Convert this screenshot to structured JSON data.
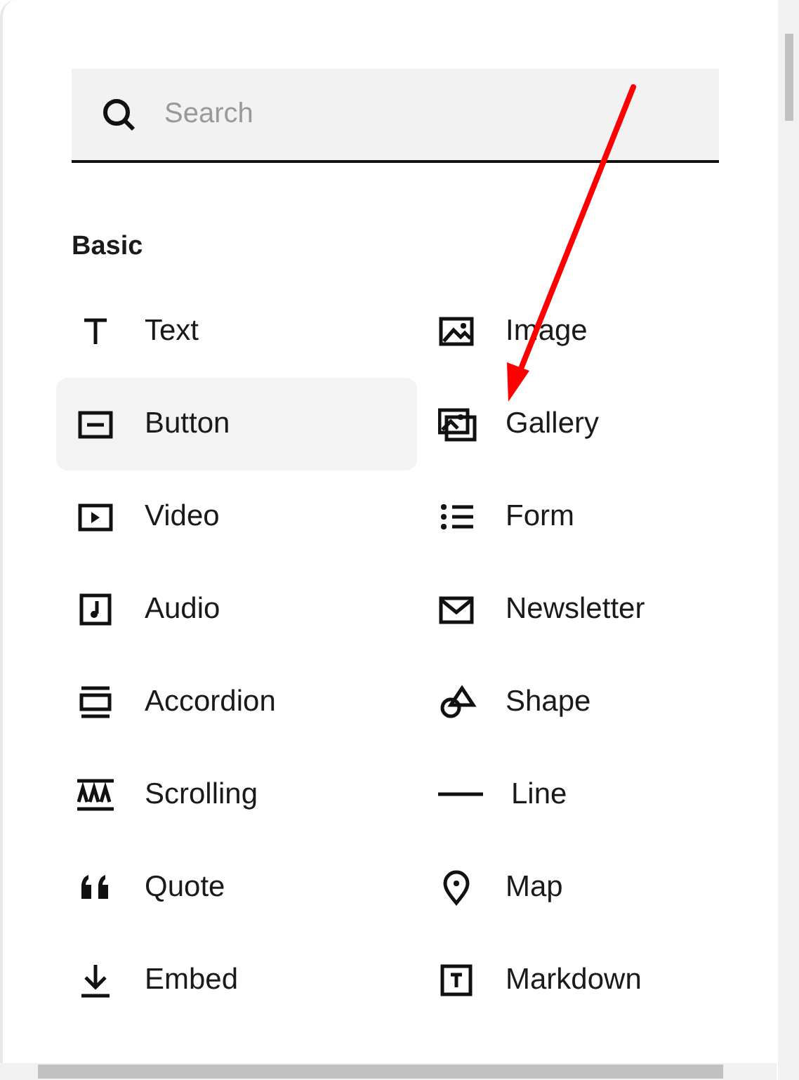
{
  "search": {
    "placeholder": "Search"
  },
  "section": {
    "title": "Basic"
  },
  "blocks": [
    {
      "label": "Text",
      "hovered": false
    },
    {
      "label": "Image",
      "hovered": false
    },
    {
      "label": "Button",
      "hovered": true
    },
    {
      "label": "Gallery",
      "hovered": false
    },
    {
      "label": "Video",
      "hovered": false
    },
    {
      "label": "Form",
      "hovered": false
    },
    {
      "label": "Audio",
      "hovered": false
    },
    {
      "label": "Newsletter",
      "hovered": false
    },
    {
      "label": "Accordion",
      "hovered": false
    },
    {
      "label": "Shape",
      "hovered": false
    },
    {
      "label": "Scrolling",
      "hovered": false
    },
    {
      "label": "Line",
      "hovered": false
    },
    {
      "label": "Quote",
      "hovered": false
    },
    {
      "label": "Map",
      "hovered": false
    },
    {
      "label": "Embed",
      "hovered": false
    },
    {
      "label": "Markdown",
      "hovered": false
    }
  ]
}
